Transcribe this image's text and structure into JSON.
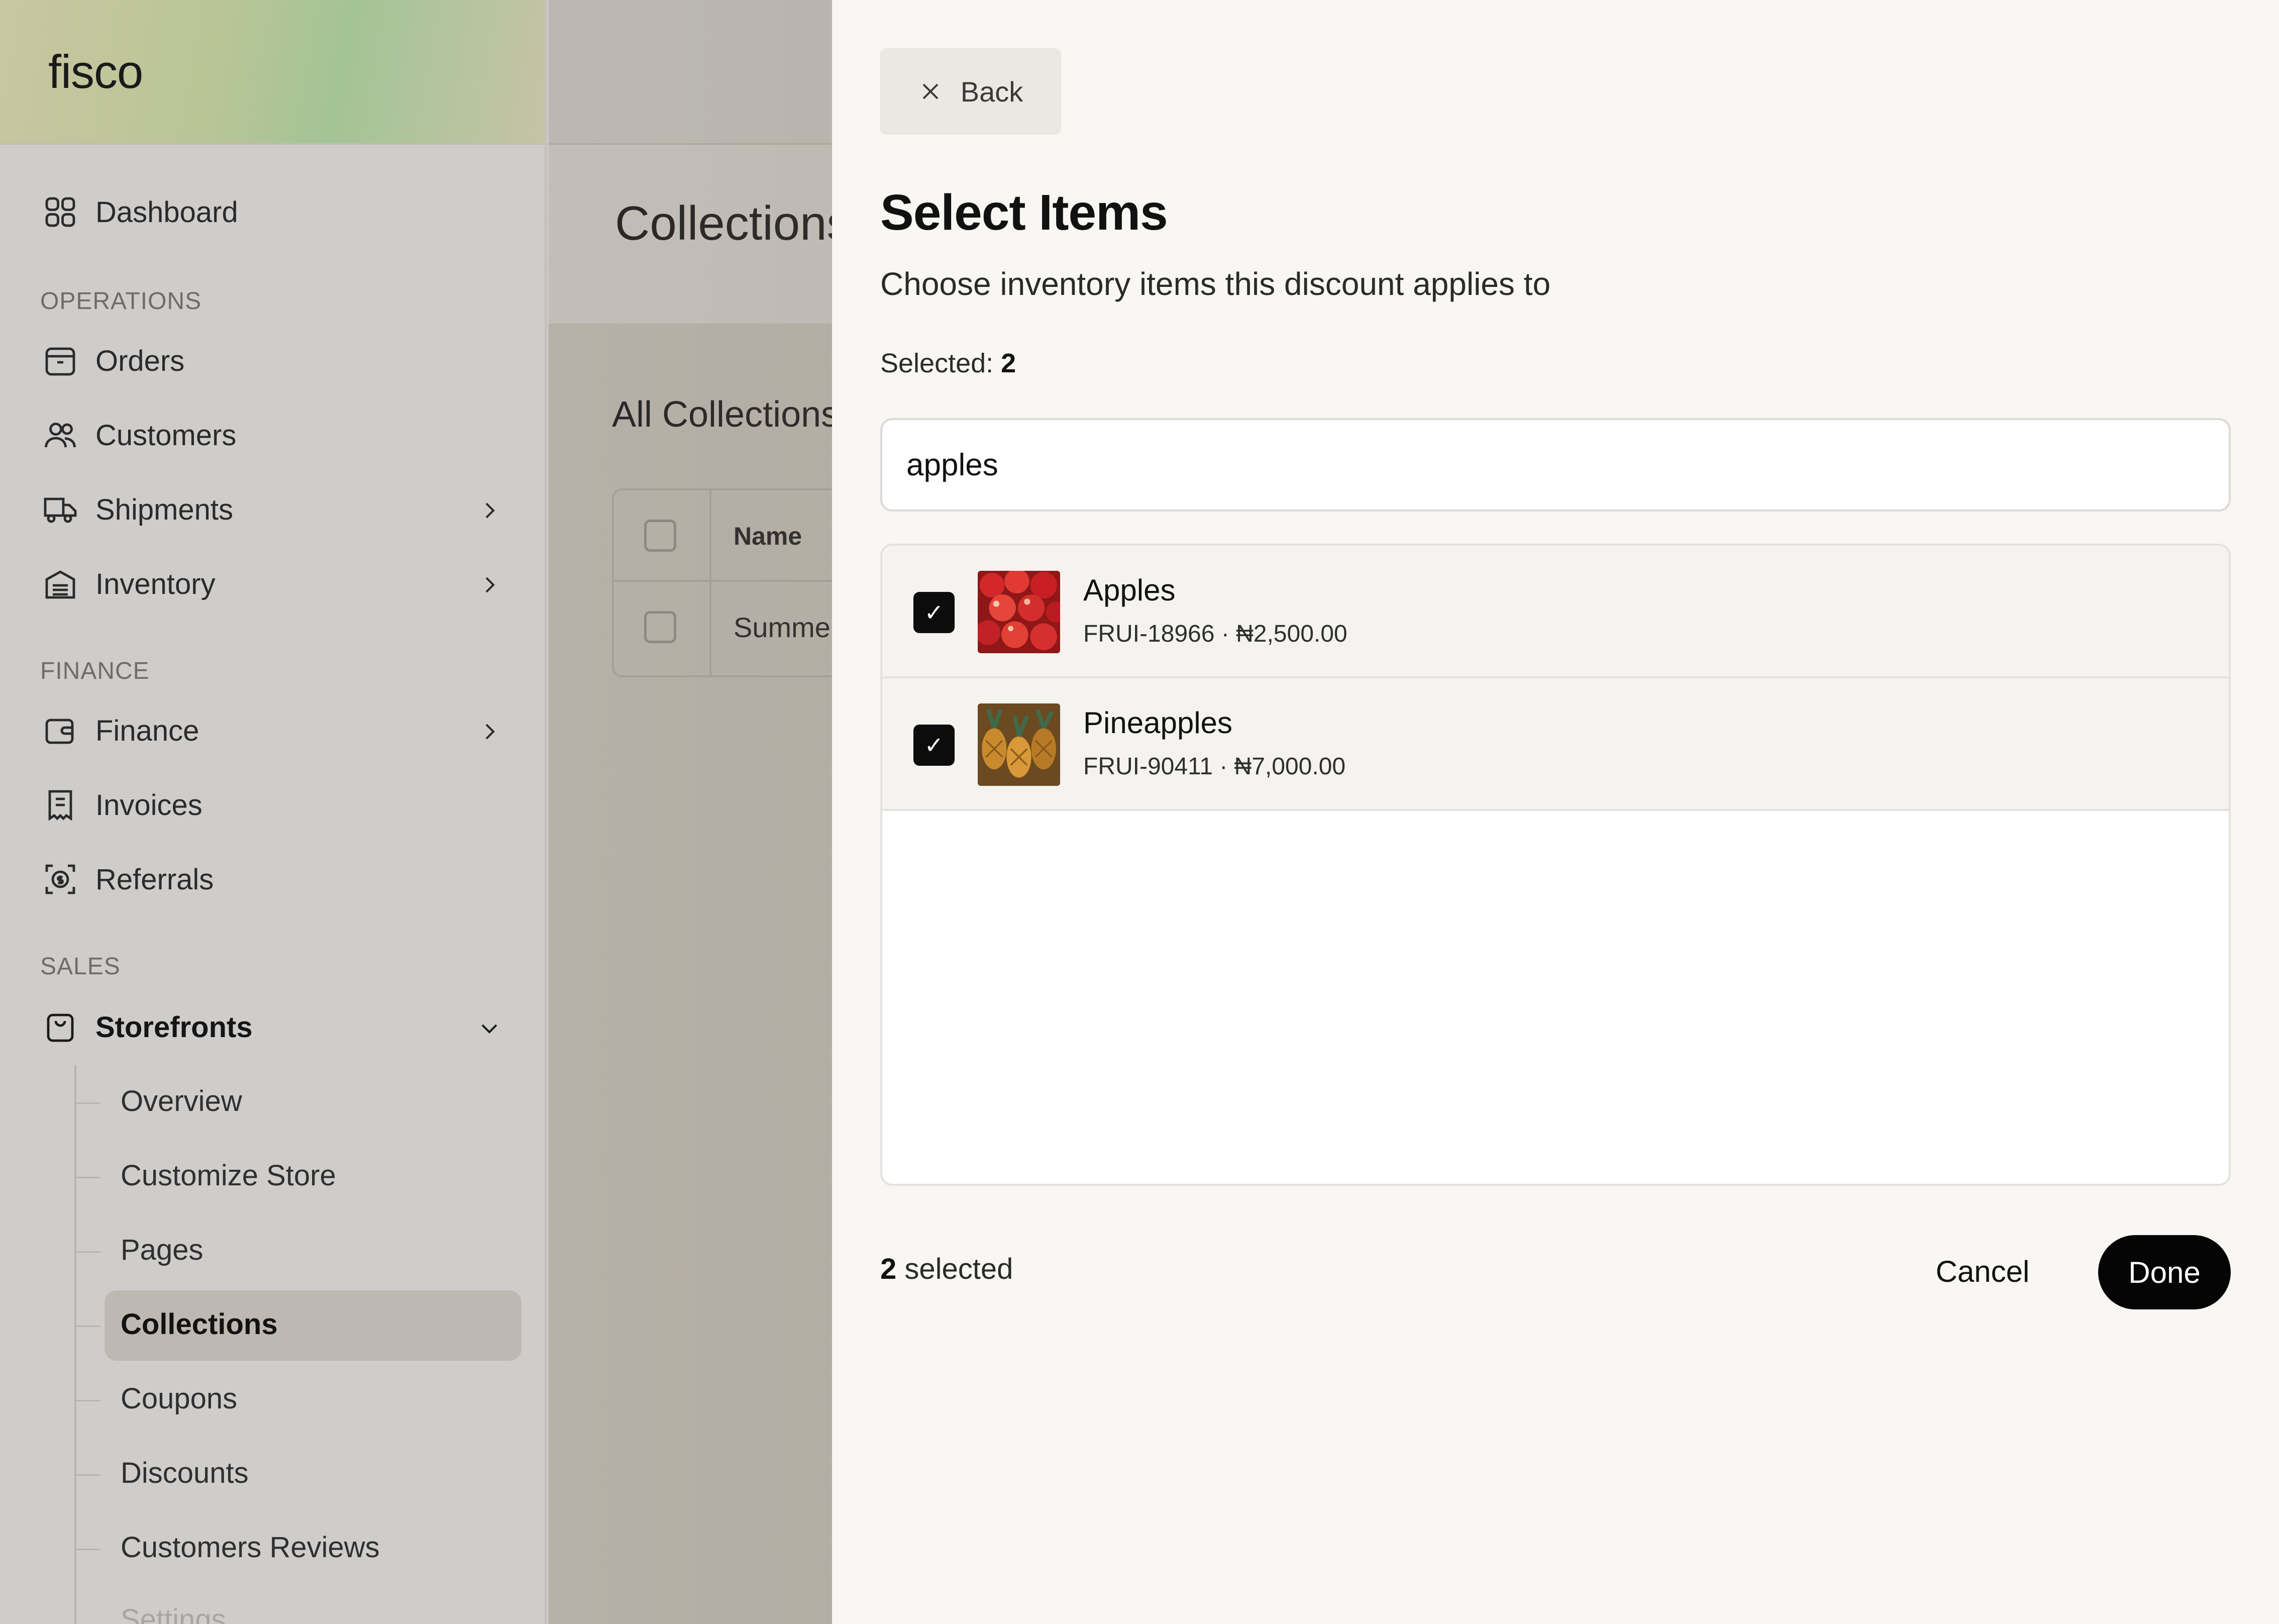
{
  "sidebar": {
    "brand": "fisco",
    "dashboard": "Dashboard",
    "sections": {
      "operations": "OPERATIONS",
      "finance": "FINANCE",
      "sales": "SALES"
    },
    "items": {
      "orders": "Orders",
      "customers": "Customers",
      "shipments": "Shipments",
      "inventory": "Inventory",
      "finance": "Finance",
      "invoices": "Invoices",
      "referrals": "Referrals",
      "storefronts": "Storefronts"
    },
    "storefront_sub": {
      "overview": "Overview",
      "customize": "Customize Store",
      "pages": "Pages",
      "collections": "Collections",
      "coupons": "Coupons",
      "discounts": "Discounts",
      "reviews": "Customers Reviews",
      "settings": "Settings"
    }
  },
  "main": {
    "title": "Collections",
    "subtitle": "All Collections",
    "table": {
      "header_name": "Name",
      "row_name": "Summer"
    }
  },
  "modal": {
    "back": "Back",
    "title": "Select Items",
    "subtitle": "Choose inventory items this discount applies to",
    "selected_label": "Selected:",
    "selected_count": "2",
    "search_value": "apples",
    "items": [
      {
        "name": "Apples",
        "meta": "FRUI-18966 · ₦2,500.00",
        "checked": true
      },
      {
        "name": "Pineapples",
        "meta": "FRUI-90411 · ₦7,000.00",
        "checked": true
      }
    ],
    "footer_count": "2",
    "footer_label": "selected",
    "cancel": "Cancel",
    "done": "Done"
  }
}
